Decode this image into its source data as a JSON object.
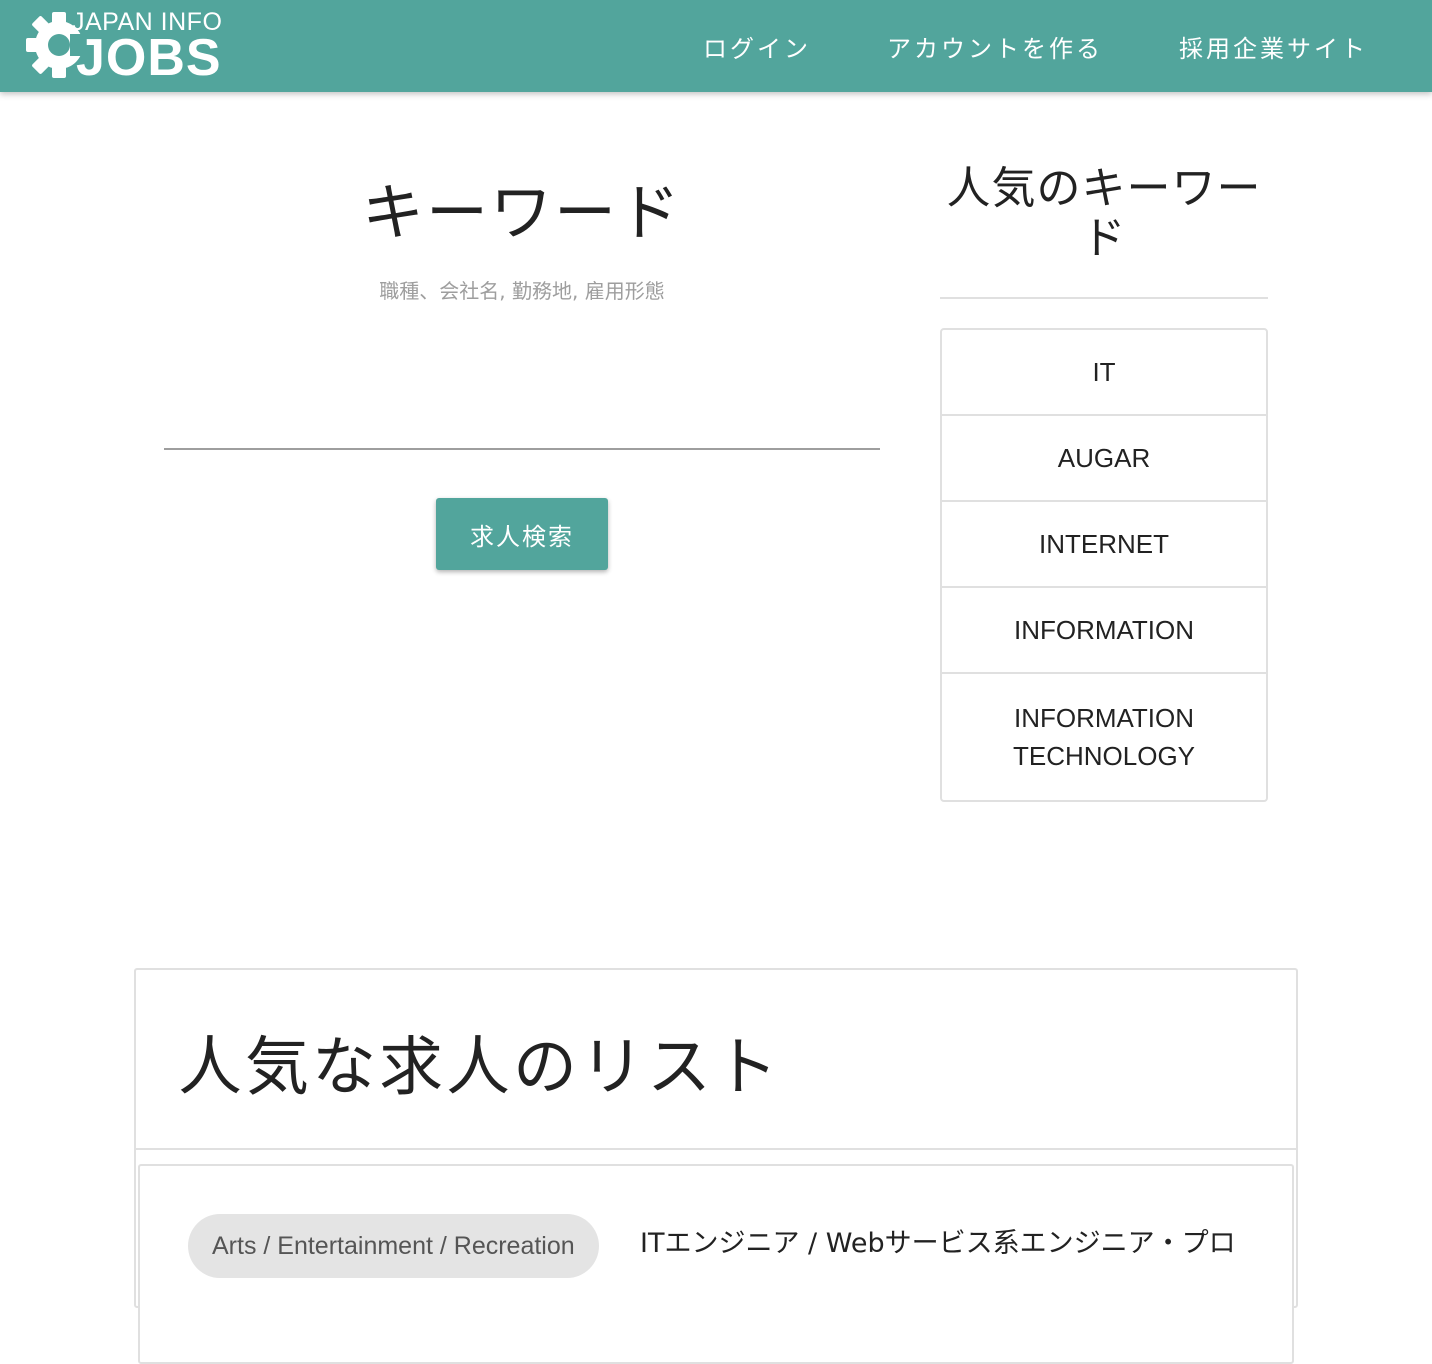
{
  "header": {
    "logo": {
      "top_text": "JAPAN INFO",
      "main_text": "JOBS"
    },
    "nav": [
      {
        "label": "ログイン"
      },
      {
        "label": "アカウントを作る"
      },
      {
        "label": "採用企業サイト"
      }
    ],
    "colors": {
      "brand": "#52a59c"
    }
  },
  "search": {
    "title": "キーワード",
    "hint": "職種、会社名, 勤務地, 雇用形態",
    "input_value": "",
    "button_label": "求人検索"
  },
  "popular_keywords": {
    "title": "人気のキーワード",
    "items": [
      {
        "label": "IT"
      },
      {
        "label": "AUGAR"
      },
      {
        "label": "INTERNET"
      },
      {
        "label": "INFORMATION"
      },
      {
        "label": "INFORMATION TECHNOLOGY"
      }
    ]
  },
  "popular_jobs": {
    "title": "人気な求人のリスト",
    "items": [
      {
        "category": "Arts / Entertainment / Recreation",
        "title": "ITエンジニア / Webサービス系エンジニア・プロ"
      }
    ]
  }
}
